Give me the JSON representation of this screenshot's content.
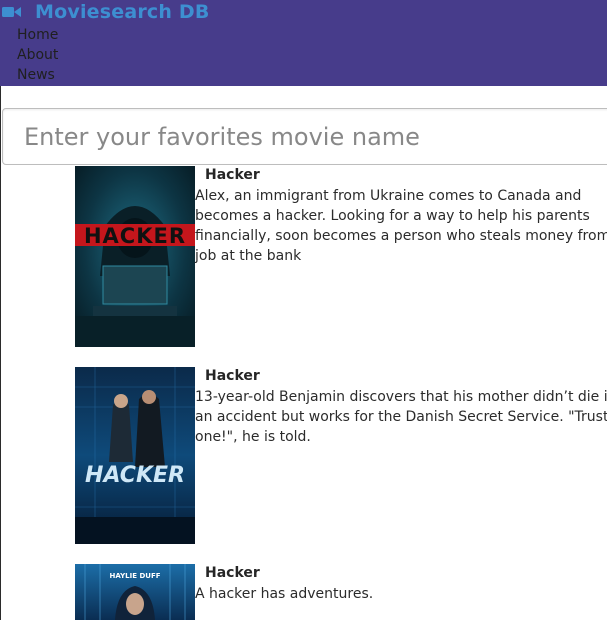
{
  "header": {
    "brand": "Moviesearch DB",
    "brand_icon": "video-camera-icon",
    "brand_color": "#3d8fd1",
    "background": "#473c8b",
    "nav": [
      {
        "label": "Home"
      },
      {
        "label": "About"
      },
      {
        "label": "News"
      }
    ]
  },
  "search": {
    "placeholder": "Enter your favorites movie name",
    "value": ""
  },
  "results": [
    {
      "title": "Hacker",
      "description": "Alex, an immigrant from Ukraine comes to Canada and becomes a hacker. Looking for a way to help his parents financially, soon becomes a person who steals money from his job at the bank",
      "poster_text": "HACKER"
    },
    {
      "title": "Hacker",
      "description": "13-year-old Benjamin discovers that his mother didn’t die in an accident but works for the Danish Secret Service. \"Trust no one!\", he is told.",
      "poster_text": "HACKER"
    },
    {
      "title": "Hacker",
      "description": "A hacker has adventures.",
      "poster_text": "HAYLIE DUFF"
    }
  ]
}
